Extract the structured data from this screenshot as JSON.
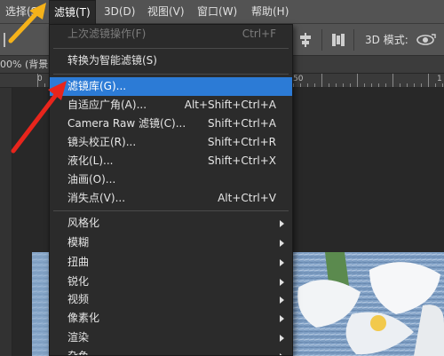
{
  "menubar": {
    "items": [
      {
        "label": "选择(S)"
      },
      {
        "label": "滤镜(T)"
      },
      {
        "label": "3D(D)"
      },
      {
        "label": "视图(V)"
      },
      {
        "label": "窗口(W)"
      },
      {
        "label": "帮助(H)"
      }
    ]
  },
  "options_bar": {
    "mode_label": "3D 模式:",
    "icons": [
      "align-icon",
      "distribute-icon",
      "rotate-3d-icon"
    ]
  },
  "document": {
    "tab_title": "00% (背景"
  },
  "ruler": {
    "labels": [
      "0",
      "50",
      "1"
    ]
  },
  "filter_menu": {
    "items": [
      {
        "label": "上次滤镜操作(F)",
        "shortcut": "Ctrl+F",
        "disabled": true
      },
      {
        "label": "转换为智能滤镜(S)",
        "shortcut": ""
      },
      {
        "label": "滤镜库(G)...",
        "shortcut": "",
        "highlighted": true
      },
      {
        "label": "自适应广角(A)...",
        "shortcut": "Alt+Shift+Ctrl+A"
      },
      {
        "label": "Camera Raw 滤镜(C)...",
        "shortcut": "Shift+Ctrl+A"
      },
      {
        "label": "镜头校正(R)...",
        "shortcut": "Shift+Ctrl+R"
      },
      {
        "label": "液化(L)...",
        "shortcut": "Shift+Ctrl+X"
      },
      {
        "label": "油画(O)...",
        "shortcut": ""
      },
      {
        "label": "消失点(V)...",
        "shortcut": "Alt+Ctrl+V"
      },
      {
        "label": "风格化",
        "submenu": true
      },
      {
        "label": "模糊",
        "submenu": true
      },
      {
        "label": "扭曲",
        "submenu": true
      },
      {
        "label": "锐化",
        "submenu": true
      },
      {
        "label": "视频",
        "submenu": true
      },
      {
        "label": "像素化",
        "submenu": true
      },
      {
        "label": "渲染",
        "submenu": true
      },
      {
        "label": "杂色",
        "submenu": true
      }
    ]
  },
  "colors": {
    "highlight": "#2c7bd6",
    "arrow_orange": "#f5b21a",
    "arrow_red": "#e8251c"
  }
}
